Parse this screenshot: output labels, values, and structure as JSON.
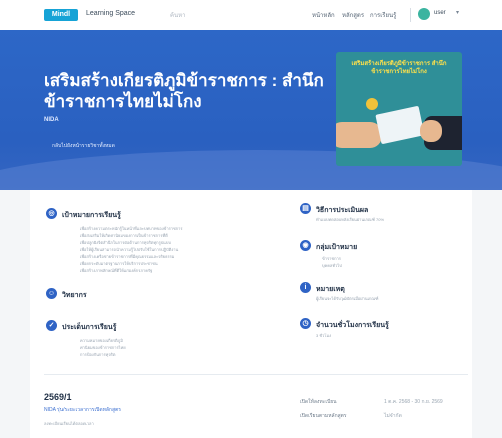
{
  "topbar": {
    "logo_text": "Mindl",
    "app_name": "Learning Space",
    "search_text": "ค้นหา",
    "nav": [
      "หน้าหลัก",
      "หลักสูตร",
      "การเรียนรู้"
    ],
    "user_name": "user"
  },
  "hero": {
    "title": "เสริมสร้างเกียรติภูมิข้าราชการ : สำนึกข้าราชการไทยไม่โกง",
    "subtitle": "NIDA",
    "link": "กลับไปยังหน้ารายวิชาทั้งหมด",
    "image_caption": "เสริมสร้างเกียรติภูมิข้าราชการ สำนึกข้าราชการไทยไม่โกง"
  },
  "sections": {
    "objectives": {
      "title": "เป้าหมายการเรียนรู้",
      "lines": [
        "เพื่อสร้างความตระหนักรู้ในหน้าที่และบทบาทของข้าราชการ",
        "เพื่อส่งเสริมให้เกิดค่านิยมของการเป็นข้าราชการที่ดี",
        "เพื่อปลูกฝังจิตสำนึกในการต่อต้านการทุจริตทุกรูปแบบ",
        "เพื่อให้ผู้เรียนสามารถนำความรู้ไปปรับใช้ในการปฏิบัติงาน",
        "เพื่อสร้างเครือข่ายข้าราชการที่มีคุณธรรมและจริยธรรม",
        "เพื่อยกระดับมาตรฐานการให้บริการประชาชน",
        "เพื่อสร้างภาพลักษณ์ที่ดีให้แก่องค์กรภาครัฐ"
      ]
    },
    "instructor": {
      "title": "วิทยากร"
    },
    "outcomes": {
      "title": "ประเด็นการเรียนรู้",
      "lines": [
        "ความหมายของเกียรติภูมิ",
        "ค่านิยมของข้าราชการไทย",
        "การป้องกันการทุจริต"
      ]
    },
    "evaluation": {
      "title": "วิธีการประเมินผล",
      "line": "ทำแบบทดสอบหลังเรียนผ่านเกณฑ์ 70%"
    },
    "audience": {
      "title": "กลุ่มเป้าหมาย",
      "lines": [
        "ข้าราชการ",
        "บุคคลทั่วไป"
      ]
    },
    "notes": {
      "title": "หมายเหตุ",
      "line": "ผู้เรียนจะได้รับวุฒิบัตรเมื่อผ่านเกณฑ์"
    },
    "hours": {
      "title": "จำนวนชั่วโมงการเรียนรู้",
      "line": "3 ชั่วโมง"
    }
  },
  "term": {
    "title": "2569/1",
    "link": "NIDA รุ่น/ระยะเวลาการเปิดหลักสูตร",
    "note": "ลงทะเบียนเรียนได้ตลอดเวลา",
    "meta": [
      {
        "label": "เปิดให้ลงทะเบียน",
        "value": "1 ต.ค. 2568 - 30 ก.ย. 2569"
      },
      {
        "label": "เปิดเรียนตามหลักสูตร",
        "value": "ไม่จำกัด"
      }
    ]
  },
  "colors": {
    "hero": "#2d67c7",
    "accent": "#2f63c5",
    "image_bg": "#2f8f98"
  }
}
